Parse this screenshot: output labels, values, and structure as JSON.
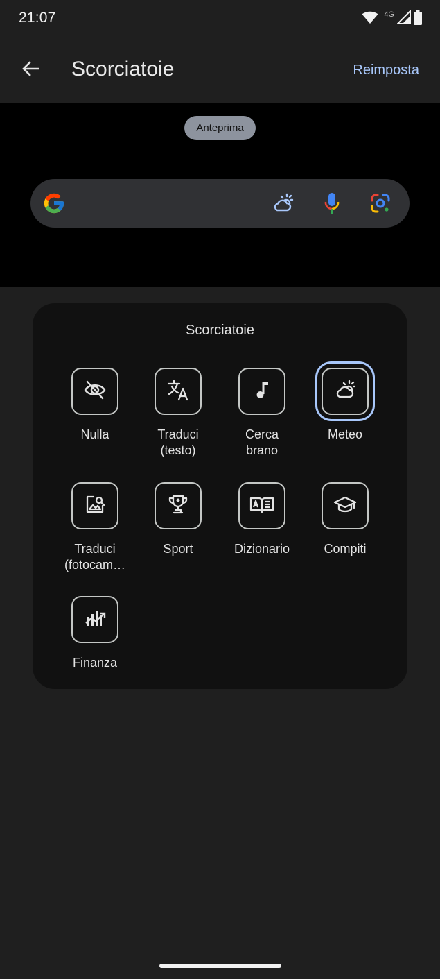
{
  "status_bar": {
    "time": "21:07",
    "network": "4G",
    "icons": [
      "wifi-icon",
      "cell-signal-icon",
      "battery-icon"
    ]
  },
  "app_bar": {
    "back_icon": "arrow-back-icon",
    "title": "Scorciatoie",
    "action": "Reimposta"
  },
  "preview": {
    "chip_label": "Anteprima",
    "search_bar_icons": [
      "google-g-icon",
      "weather-icon",
      "mic-icon",
      "lens-icon"
    ]
  },
  "shortcuts": {
    "title": "Scorciatoie",
    "selected": "Meteo",
    "items": [
      {
        "label": "Nulla",
        "icon": "eye-off-icon"
      },
      {
        "label": "Traduci\n(testo)",
        "icon": "translate-icon"
      },
      {
        "label": "Cerca\nbrano",
        "icon": "music-note-icon"
      },
      {
        "label": "Meteo",
        "icon": "weather-icon"
      },
      {
        "label": "Traduci\n(fotocam…",
        "icon": "image-search-icon"
      },
      {
        "label": "Sport",
        "icon": "trophy-icon"
      },
      {
        "label": "Dizionario",
        "icon": "dictionary-icon"
      },
      {
        "label": "Compiti",
        "icon": "school-cap-icon"
      },
      {
        "label": "Finanza",
        "icon": "finance-chart-icon"
      }
    ]
  },
  "colors": {
    "background": "#1f1f1f",
    "preview_bg": "#000000",
    "card_bg": "#111111",
    "accent": "#a8c7fa",
    "text": "#e3e3e3"
  }
}
